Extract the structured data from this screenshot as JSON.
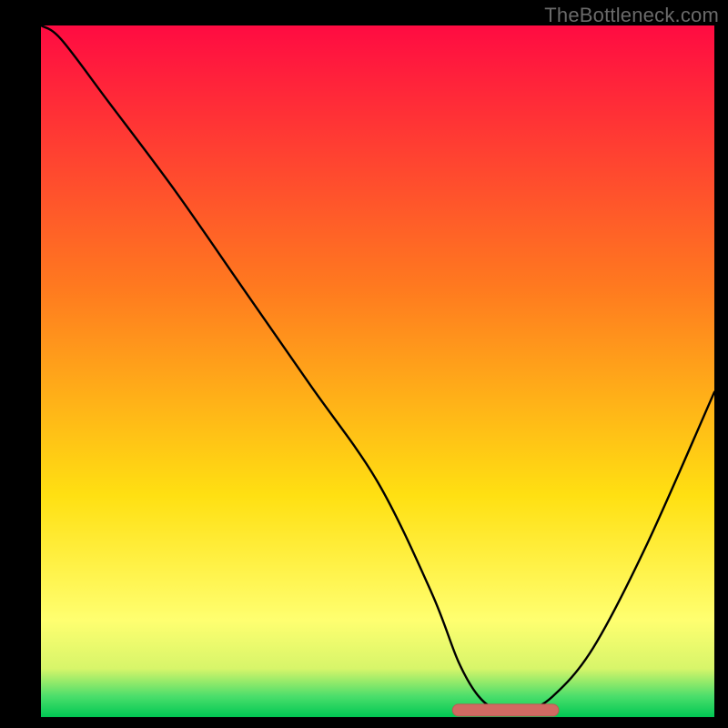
{
  "watermark": "TheBottleneck.com",
  "colors": {
    "frame": "#000000",
    "curve": "#000000",
    "marker_fill": "#d16a62",
    "marker_stroke": "#bd5a53",
    "grad_top": "#ff0b42",
    "grad_mid1": "#ff7a1f",
    "grad_mid2": "#ffe012",
    "grad_low": "#ffff70",
    "grad_green1": "#4bde6b",
    "grad_green2": "#00c853"
  },
  "chart_data": {
    "type": "line",
    "title": "",
    "xlabel": "",
    "ylabel": "",
    "xlim": [
      0,
      100
    ],
    "ylim": [
      0,
      100
    ],
    "x": [
      0,
      3,
      10,
      20,
      30,
      40,
      50,
      58,
      62,
      65,
      68,
      72,
      76,
      82,
      90,
      100
    ],
    "values": [
      100,
      98,
      89,
      76,
      62,
      48,
      34,
      18,
      8,
      3,
      1,
      1,
      3,
      10,
      25,
      47
    ],
    "optimal_range_x": [
      62,
      76
    ],
    "optimal_value": 1,
    "annotations": []
  }
}
